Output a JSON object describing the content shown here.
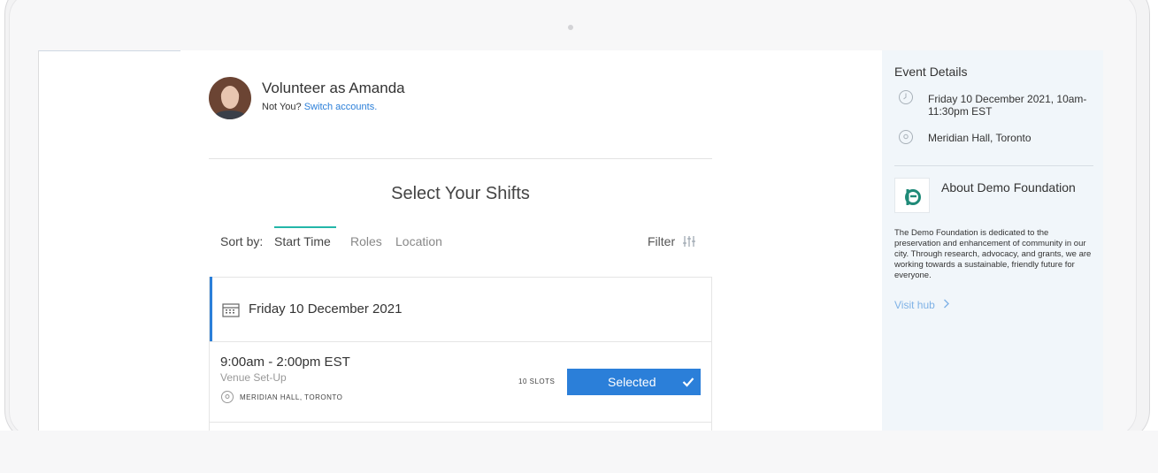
{
  "user": {
    "volunteer_title": "Volunteer as Amanda",
    "not_you": "Not You?",
    "switch_link": "Switch accounts."
  },
  "main": {
    "section_title": "Select Your Shifts",
    "sort_label": "Sort by:",
    "sort_tabs": [
      "Start Time",
      "Roles",
      "Location"
    ],
    "active_tab": "Start Time",
    "filter_label": "Filter"
  },
  "shift_card": {
    "date": "Friday 10 December 2021",
    "shift": {
      "time": "9:00am - 2:00pm EST",
      "role": "Venue Set-Up",
      "location": "MERIDIAN HALL, TORONTO",
      "slots": "10 SLOTS",
      "button_label": "Selected"
    }
  },
  "sidebar": {
    "event_details_heading": "Event Details",
    "datetime": "Friday 10 December 2021, 10am-11:30pm EST",
    "venue": "Meridian Hall, Toronto",
    "about_title": "About Demo Foundation",
    "about_text": "The Demo Foundation is dedicated to the preservation and enhancement of community in our city. Through research, advocacy, and grants, we are working towards a sustainable, friendly future for everyone.",
    "visit_hub": "Visit hub"
  },
  "colors": {
    "accent_blue": "#2b7fd9",
    "tab_underline_teal": "#23b6a8",
    "sidebar_bg": "#f1f6fa",
    "logo_green": "#1f8a78"
  }
}
